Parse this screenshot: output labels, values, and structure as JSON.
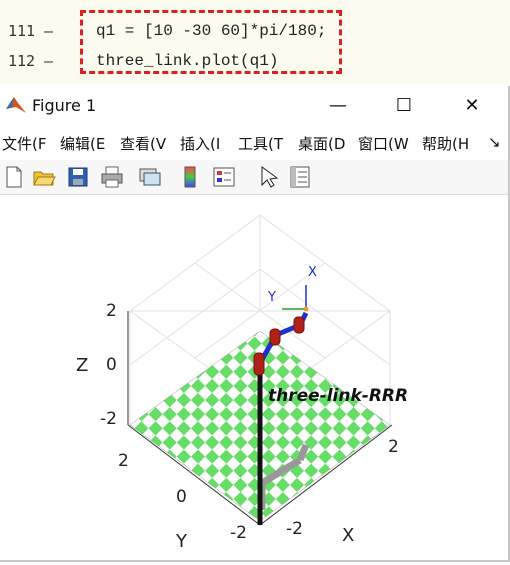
{
  "editor": {
    "lines": [
      {
        "num": "111",
        "dash": "—",
        "code": "q1 = [10 -30 60]*pi/180;"
      },
      {
        "num": "112",
        "dash": "—",
        "code": "three_link.plot(q1)"
      }
    ]
  },
  "window": {
    "title": "Figure 1",
    "minimize": "—",
    "maximize": "☐",
    "close": "✕"
  },
  "menu": [
    "文件(F",
    "编辑(E",
    "查看(V",
    "插入(I",
    "工具(T",
    "桌面(D",
    "窗口(W",
    "帮助(H"
  ],
  "menu_overflow": "↘",
  "plot": {
    "robot_name": "three-link-RRR",
    "z_axis_label": "Z",
    "y_axis_label": "Y",
    "x_axis_label": "X",
    "z_ticks": [
      "2",
      "0",
      "-2"
    ],
    "y_ticks": [
      "2",
      "0",
      "-2"
    ],
    "x_ticks": [
      "2",
      "-2"
    ],
    "frame_x": "X",
    "frame_y": "Y",
    "colors": {
      "floor_green": "#66dd66",
      "floor_white": "#ffffff",
      "link_blue": "#1f2fd0",
      "joint_red": "#b02018"
    }
  }
}
